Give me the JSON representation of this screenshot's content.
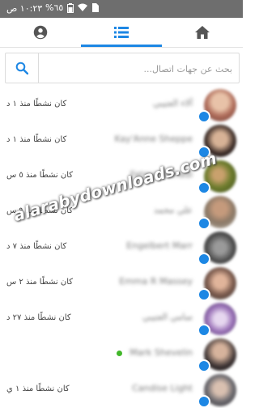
{
  "status_bar": {
    "time": "١٠:٢٣ ص",
    "battery": "%٦٥"
  },
  "tabs": [
    {
      "icon": "home-icon",
      "active": false
    },
    {
      "icon": "list-icon",
      "active": true
    },
    {
      "icon": "profile-icon",
      "active": false
    }
  ],
  "colors": {
    "accent": "#1d87e4",
    "online": "#42b72a",
    "status_bar": "#6e6e6e"
  },
  "search": {
    "placeholder": "بحث عن جهات اتصال..."
  },
  "contacts": [
    {
      "name": "آلاء العتيبي",
      "status": "كان نشطًا منذ ١ د"
    },
    {
      "name": "Kay'Anne Sheppe",
      "status": "كان نشطًا منذ ١ د"
    },
    {
      "name": "Fatma Mahadi",
      "status": "كان نشطًا منذ ٥ س"
    },
    {
      "name": "علي محمد",
      "status": "كان نشطًا منذ ٩ س"
    },
    {
      "name": "Engelbert Marr",
      "status": "كان نشطًا منذ ٧ د"
    },
    {
      "name": "Emma R Massey",
      "status": "كان نشطًا منذ ٢ س"
    },
    {
      "name": "سامي العتيبي",
      "status": "كان نشطًا منذ ٢٧ د"
    },
    {
      "name": "Mark Shevelin",
      "status": "",
      "online": true
    },
    {
      "name": "Candise Light",
      "status": "كان نشطًا منذ ١ ي"
    }
  ],
  "watermark": "alarabydownloads.com"
}
